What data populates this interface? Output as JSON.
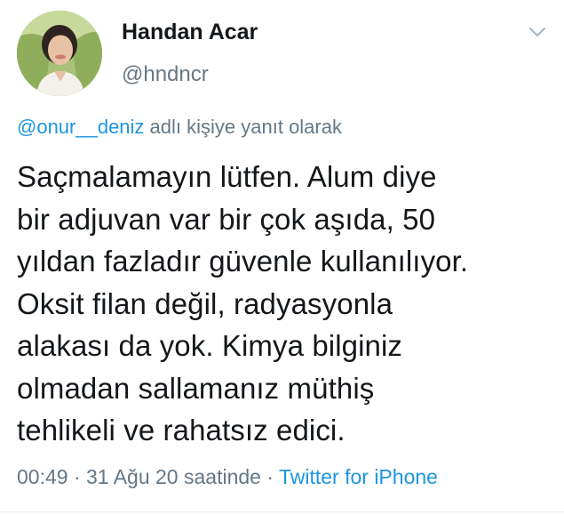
{
  "author": {
    "display_name": "Handan Acar",
    "handle": "@hndncr",
    "avatar_icon": "profile-photo"
  },
  "reply": {
    "mention": "@onur__deniz",
    "suffix": " adlı kişiye yanıt olarak"
  },
  "tweet": {
    "lines": [
      "Saçmalamayın lütfen. Alum diye",
      "bir adjuvan var bir çok aşıda, 50",
      "yıldan fazladır güvenle kullanılıyor.",
      "Oksit filan değil, radyasyonla",
      "alakası da yok. Kimya bilginiz",
      "olmadan sallamanız müthiş",
      "tehlikeli ve rahatsız edici."
    ]
  },
  "meta": {
    "timestamp": "00:49 · 31 Ağu 20 saatinde · ",
    "source": "Twitter for iPhone"
  },
  "menu": {
    "icon": "chevron-down-icon"
  },
  "colors": {
    "link": "#1b95e0",
    "secondary_text": "#657786",
    "primary_text": "#14171a"
  }
}
